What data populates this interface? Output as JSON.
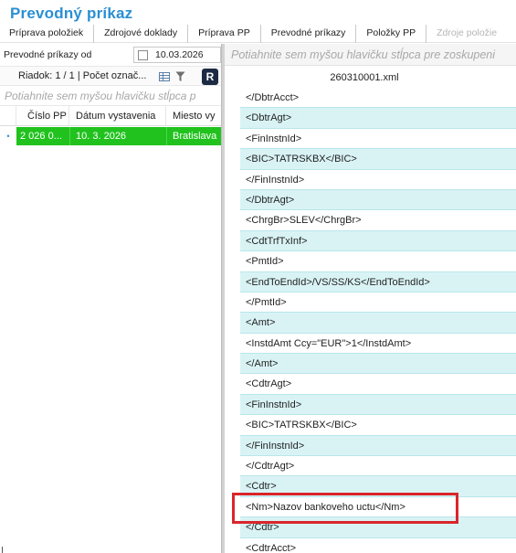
{
  "app": {
    "title": "Prevodný príkaz"
  },
  "tabs": [
    {
      "label": "Príprava položiek",
      "enabled": true
    },
    {
      "label": "Zdrojové doklady",
      "enabled": true
    },
    {
      "label": "Príprava PP",
      "enabled": true
    },
    {
      "label": "Prevodné príkazy",
      "enabled": true
    },
    {
      "label": "Položky PP",
      "enabled": true
    },
    {
      "label": "Zdroje položie",
      "enabled": false
    }
  ],
  "filter": {
    "label": "Prevodné príkazy od",
    "checked": false,
    "date": "10.03.2026"
  },
  "row_info": {
    "text": "Riadok: 1 / 1 | Počet označ...",
    "app_icon_glyph": "R"
  },
  "left_group_hint": "Potiahnite sem myšou hlavičku stĺpca p",
  "table": {
    "columns": [
      "Číslo PP",
      "Dátum vystavenia",
      "Miesto vy"
    ],
    "rows": [
      {
        "marker": "•",
        "cells": [
          "2 026 0...",
          "10. 3. 2026",
          "Bratislava"
        ],
        "color": "#21c21e"
      }
    ]
  },
  "right": {
    "group_hint": "Potiahnite sem myšou hlavičku stĺpca pre zoskupeni",
    "file_name": "260310001.xml",
    "xml_lines": [
      "</DbtrAcct>",
      "<DbtrAgt>",
      "<FinInstnId>",
      "<BIC>TATRSKBX</BIC>",
      "</FinInstnId>",
      "</DbtrAgt>",
      "<ChrgBr>SLEV</ChrgBr>",
      "<CdtTrfTxInf>",
      "<PmtId>",
      "<EndToEndId>/VS/SS/KS</EndToEndId>",
      "</PmtId>",
      "<Amt>",
      "<InstdAmt Ccy=\"EUR\">1</InstdAmt>",
      "</Amt>",
      "<CdtrAgt>",
      "<FinInstnId>",
      "<BIC>TATRSKBX</BIC>",
      "</FinInstnId>",
      "</CdtrAgt>",
      "<Cdtr>",
      "<Nm>Nazov bankoveho uctu</Nm>",
      "</Cdtr>",
      "<CdtrAcct>"
    ],
    "highlighted_line": "<Nm>Nazov bankoveho uctu</Nm>",
    "highlight_color": "#d9262b"
  }
}
